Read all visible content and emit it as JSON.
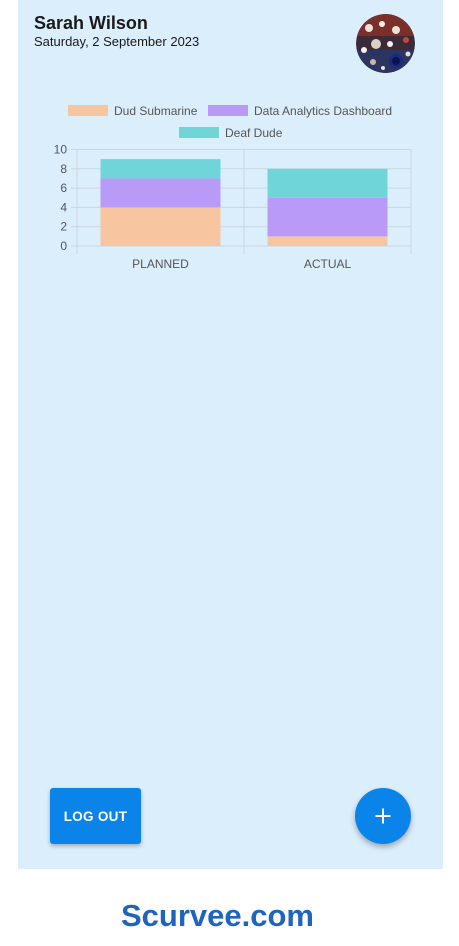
{
  "header": {
    "user_name": "Sarah Wilson",
    "date": "Saturday, 2 September 2023"
  },
  "buttons": {
    "logout_label": "LOG OUT"
  },
  "icons": {
    "fab": "plus-icon",
    "avatar": "avatar-image"
  },
  "footer": {
    "brand": "Scurvee.com"
  },
  "colors": {
    "panel_bg": "#dbeefc",
    "primary": "#0b84ea",
    "brand": "#1f64bd"
  },
  "chart_data": {
    "type": "bar",
    "stacked": true,
    "categories": [
      "PLANNED",
      "ACTUAL"
    ],
    "series": [
      {
        "name": "Dud Submarine",
        "values": [
          4,
          1
        ],
        "color": "#f7c6a0"
      },
      {
        "name": "Data Analytics Dashboard",
        "values": [
          3,
          4
        ],
        "color": "#b99bf7"
      },
      {
        "name": "Deaf Dude",
        "values": [
          2,
          3
        ],
        "color": "#70d5d8"
      }
    ],
    "ylim": [
      0,
      10
    ],
    "yticks": [
      0,
      2,
      4,
      6,
      8,
      10
    ],
    "grid": true,
    "legend": "top"
  }
}
